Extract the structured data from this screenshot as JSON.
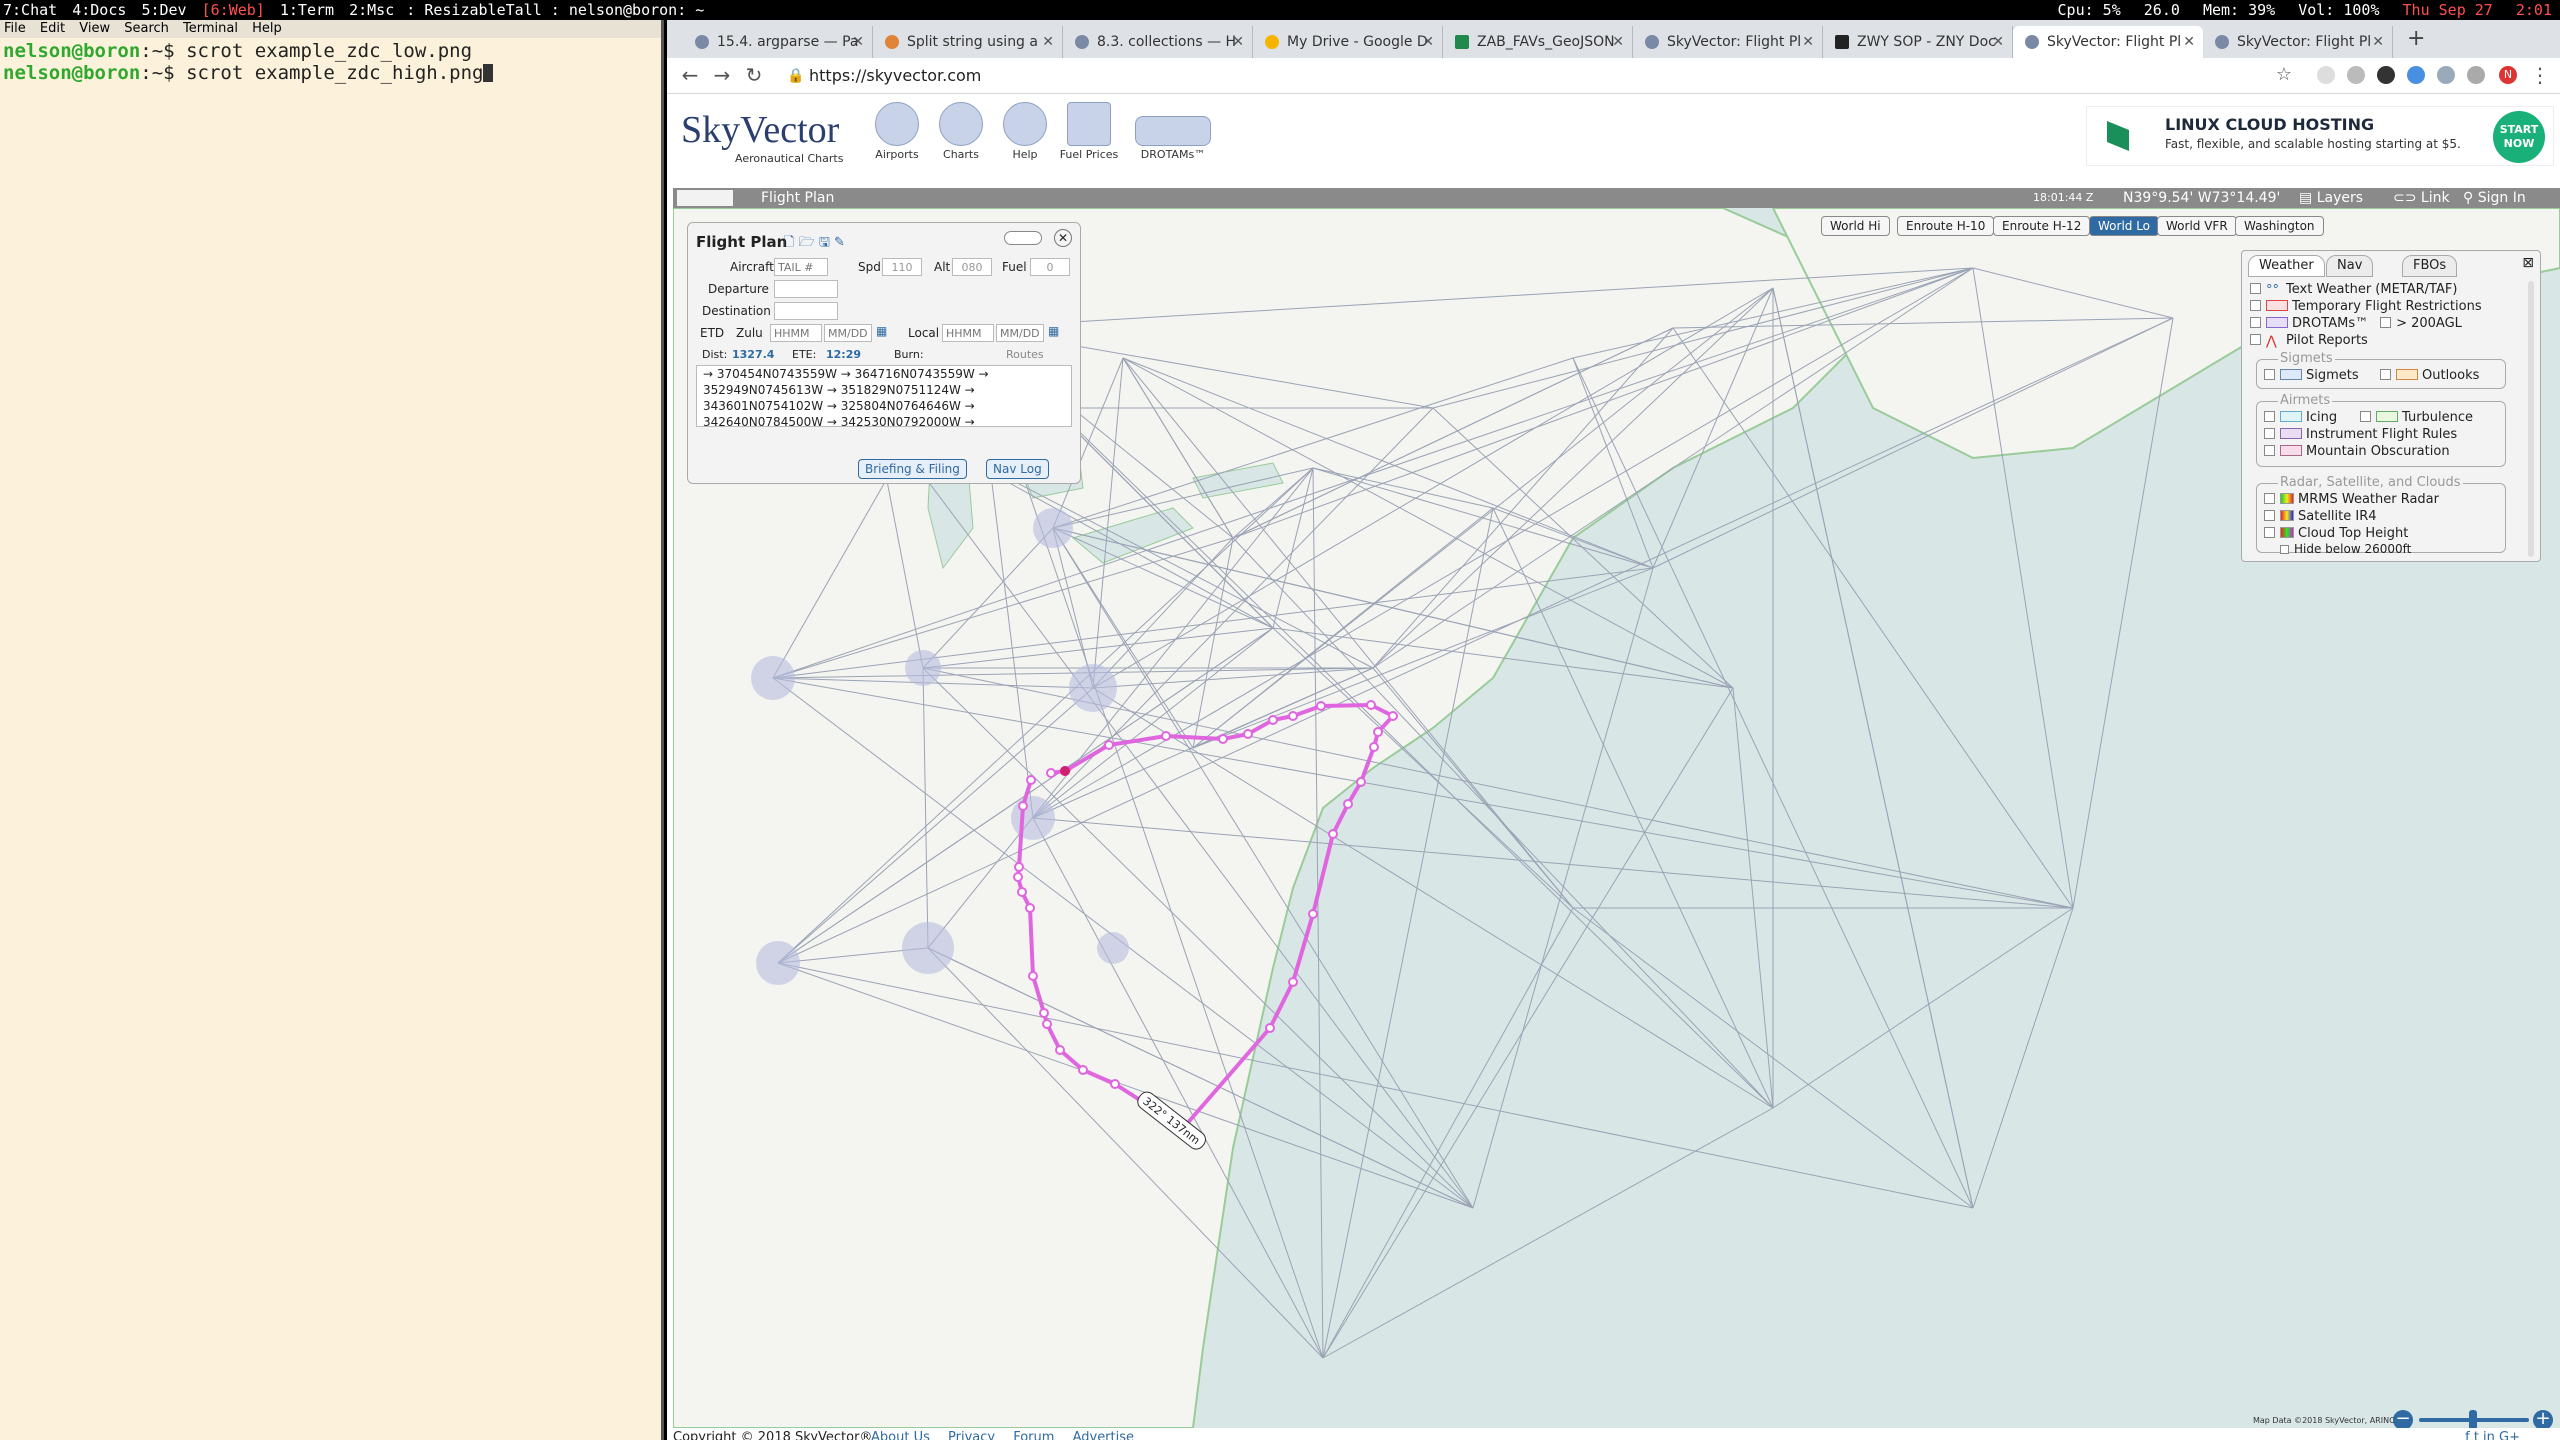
{
  "topbar": {
    "workspaces": [
      "7:Chat",
      "4:Docs",
      "5:Dev",
      "[6:Web]",
      "1:Term",
      "2:Msc"
    ],
    "layout": "ResizableTall",
    "window_title": "nelson@boron: ~",
    "cpu": "Cpu: 5%",
    "temp": "26.0",
    "mem": "Mem: 39%",
    "vol": "Vol: 100%",
    "date": "Thu Sep 27",
    "time": "2:01"
  },
  "terminal": {
    "menu": [
      "File",
      "Edit",
      "View",
      "Search",
      "Terminal",
      "Help"
    ],
    "prompt": "nelson@boron",
    "path": ":~$",
    "lines": [
      "scrot example_zdc_low.png",
      "scrot example_zdc_high.png"
    ]
  },
  "browser": {
    "tabs": [
      "15.4. argparse — Pa",
      "Split string using a",
      "8.3. collections — H",
      "My Drive - Google D",
      "ZAB_FAVs_GeoJSON",
      "SkyVector: Flight Pl",
      "ZWY SOP - ZNY Doc",
      "SkyVector: Flight Pl",
      "SkyVector: Flight Pl"
    ],
    "active_tab": 7,
    "url": "https://skyvector.com",
    "avatar_letter": "N"
  },
  "skyvector": {
    "logo": "SkyVector",
    "logo_sub": "Aeronautical Charts",
    "nav": [
      "Airports",
      "Charts",
      "Help",
      "Fuel Prices",
      "DROTAMs™"
    ],
    "ad": {
      "title": "LINUX CLOUD HOSTING",
      "desc": "Fast, flexible, and scalable hosting starting at $5.",
      "cta": "START NOW"
    },
    "bar": {
      "label": "Flight Plan",
      "time": "18:01:44 Z",
      "coords": "N39°9.54' W73°14.49'",
      "layers": "Layers",
      "link": "Link",
      "signin": "Sign In"
    },
    "chart_buttons": [
      "World Hi",
      "Enroute H-10",
      "Enroute H-12",
      "World Lo",
      "World VFR",
      "Washington"
    ],
    "active_chart": "World Lo",
    "flight_plan": {
      "title": "Flight Plan",
      "aircraft_label": "Aircraft",
      "aircraft_placeholder": "TAIL #",
      "spd_label": "Spd",
      "spd": "110",
      "alt_label": "Alt",
      "alt": "080",
      "fuel_label": "Fuel",
      "fuel": "0",
      "departure_label": "Departure",
      "destination_label": "Destination",
      "etd_label": "ETD",
      "zulu_label": "Zulu",
      "local_label": "Local",
      "hhmm": "HHMM",
      "mmdd": "MM/DD",
      "dist_label": "Dist:",
      "dist": "1327.4",
      "ete_label": "ETE:",
      "ete": "12:29",
      "burn_label": "Burn:",
      "routes_label": "Routes",
      "route_lines": [
        "→ 370454N0743559W → 364716N0743559W →",
        "352949N0745613W → 351829N0751124W →",
        "343601N0754102W → 325804N0764646W →",
        "342640N0784500W → 342530N0792000W →"
      ],
      "briefing_button": "Briefing & Filing",
      "navlog_button": "Nav Log"
    },
    "layers_panel": {
      "tabs": [
        "Weather",
        "Nav",
        "FBOs"
      ],
      "items": {
        "metar": "Text Weather (METAR/TAF)",
        "tfr": "Temporary Flight Restrictions",
        "drotam": "DROTAMs™",
        "agl": "> 200AGL",
        "pireps": "Pilot Reports",
        "sigmets_group": "Sigmets",
        "sigmets": "Sigmets",
        "outlooks": "Outlooks",
        "airmets_group": "Airmets",
        "icing": "Icing",
        "turbulence": "Turbulence",
        "ifr": "Instrument Flight Rules",
        "mtn": "Mountain Obscuration",
        "radar_group": "Radar, Satellite, and Clouds",
        "mrms": "MRMS Weather Radar",
        "satellite": "Satellite IR4",
        "cloudtop": "Cloud Top Height",
        "hide": "Hide below 26000ft"
      }
    },
    "leg_label": "322° 137nm",
    "map_credit": "Map Data ©2018 SkyVector, ARINC",
    "footer": {
      "copyright": "Copyright © 2018 SkyVector®",
      "links": [
        "About Us",
        "Privacy",
        "Forum",
        "Advertise"
      ]
    },
    "colors": {
      "route": "#e066e0",
      "water": "#d9e6e6",
      "land": "#f4f4f0"
    }
  }
}
